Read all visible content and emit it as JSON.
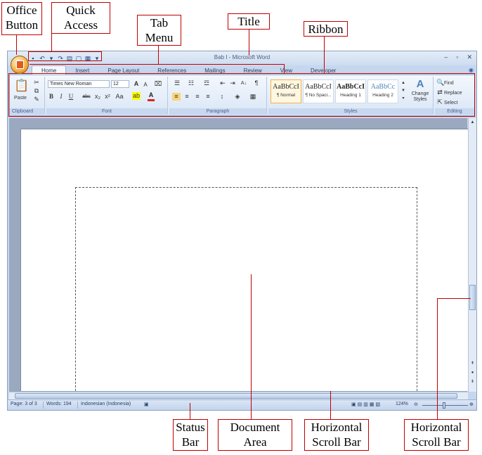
{
  "callouts": {
    "office_button": "Office\nButton",
    "quick_access": "Quick\nAccess",
    "tab_menu": "Tab\nMenu",
    "title": "Title",
    "ribbon": "Ribbon",
    "status_bar": "Status\nBar",
    "document_area": "Document\nArea",
    "hscroll_1": "Horizontal\nScroll Bar",
    "hscroll_2": "Horizontal\nScroll Bar"
  },
  "window": {
    "title": "Bab I - Microsoft Word",
    "controls": [
      "–",
      "▫",
      "✕"
    ]
  },
  "tabs": [
    "Home",
    "Insert",
    "Page Layout",
    "References",
    "Mailings",
    "Review",
    "View",
    "Developer"
  ],
  "ribbon": {
    "clipboard": {
      "label": "Clipboard",
      "paste": "Paste"
    },
    "font": {
      "label": "Font",
      "family": "Times New Roman",
      "size": "12"
    },
    "paragraph": {
      "label": "Paragraph"
    },
    "styles": {
      "label": "Styles",
      "items": [
        {
          "sample": "AaBbCcI",
          "name": "¶ Normal"
        },
        {
          "sample": "AaBbCcI",
          "name": "¶ No Spaci..."
        },
        {
          "sample": "AaBbCcI",
          "name": "Heading 1"
        },
        {
          "sample": "AaBbCc",
          "name": "Heading 2"
        }
      ],
      "change_styles": "Change\nStyles"
    },
    "editing": {
      "label": "Editing",
      "find": "Find",
      "replace": "Replace",
      "select": "Select"
    }
  },
  "status": {
    "page": "Page: 3 of 3",
    "words": "Words: 194",
    "language": "Indonesian (Indonesia)",
    "zoom": "124%"
  },
  "colors": {
    "callout_border": "#c00000",
    "ribbon_bg": "#dbe6f5",
    "page_bg": "#9aa9bf"
  }
}
